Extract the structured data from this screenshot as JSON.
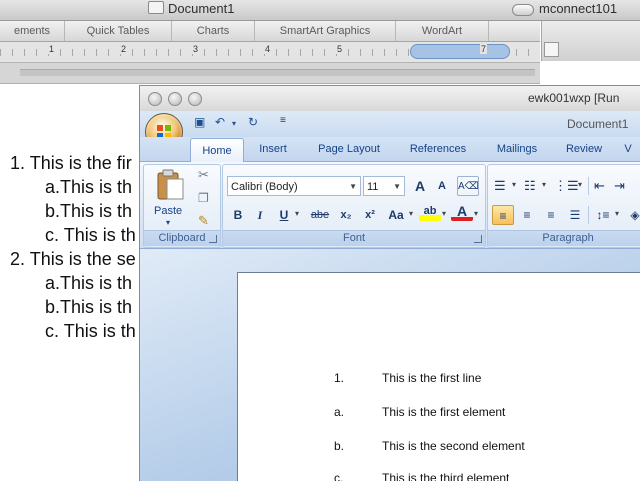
{
  "mac_window": {
    "title": "Document1",
    "remote_title": "mconnect101",
    "gallery_tabs": [
      "ements",
      "Quick Tables",
      "Charts",
      "SmartArt Graphics",
      "WordArt"
    ],
    "ruler_numbers": [
      "1",
      "2",
      "3",
      "4",
      "5",
      "7"
    ],
    "lines": [
      {
        "label": "1.",
        "text": "This is the fir"
      },
      {
        "label": "a.",
        "text": "This is th"
      },
      {
        "label": "b.",
        "text": "This is th"
      },
      {
        "label": "c.",
        "text": "This is th"
      },
      {
        "label": "2.",
        "text": "This is the se"
      },
      {
        "label": "a.",
        "text": "This is th"
      },
      {
        "label": "b.",
        "text": "This is th"
      },
      {
        "label": "c.",
        "text": "This is th"
      }
    ]
  },
  "win_window": {
    "title": "ewk001wxp [Run",
    "doc_title": "Document1",
    "tabs": [
      "Home",
      "Insert",
      "Page Layout",
      "References",
      "Mailings",
      "Review",
      "V"
    ],
    "active_tab": "Home",
    "clipboard": {
      "label": "Clipboard",
      "paste_label": "Paste"
    },
    "font": {
      "label": "Font",
      "family": "Calibri (Body)",
      "size": "11",
      "buttons": {
        "grow": "A",
        "shrink": "A",
        "bold": "B",
        "italic": "I",
        "underline": "U",
        "strike": "abe",
        "subscript": "x₂",
        "superscript": "x²",
        "change_case": "Aa",
        "highlight": "ab",
        "font_color": "A"
      }
    },
    "paragraph": {
      "label": "Paragraph"
    },
    "document_lines": [
      {
        "label": "1.",
        "text": "This is the first line"
      },
      {
        "label": "a.",
        "text": "This is the first element"
      },
      {
        "label": "b.",
        "text": "This is the second element"
      },
      {
        "label": "c.",
        "text": "This is the third element"
      }
    ]
  },
  "colors": {
    "ribbon_blue": "#c6d8ee",
    "tab_text": "#15428b",
    "highlight_yellow": "#ffff00",
    "font_red": "#e02020"
  }
}
